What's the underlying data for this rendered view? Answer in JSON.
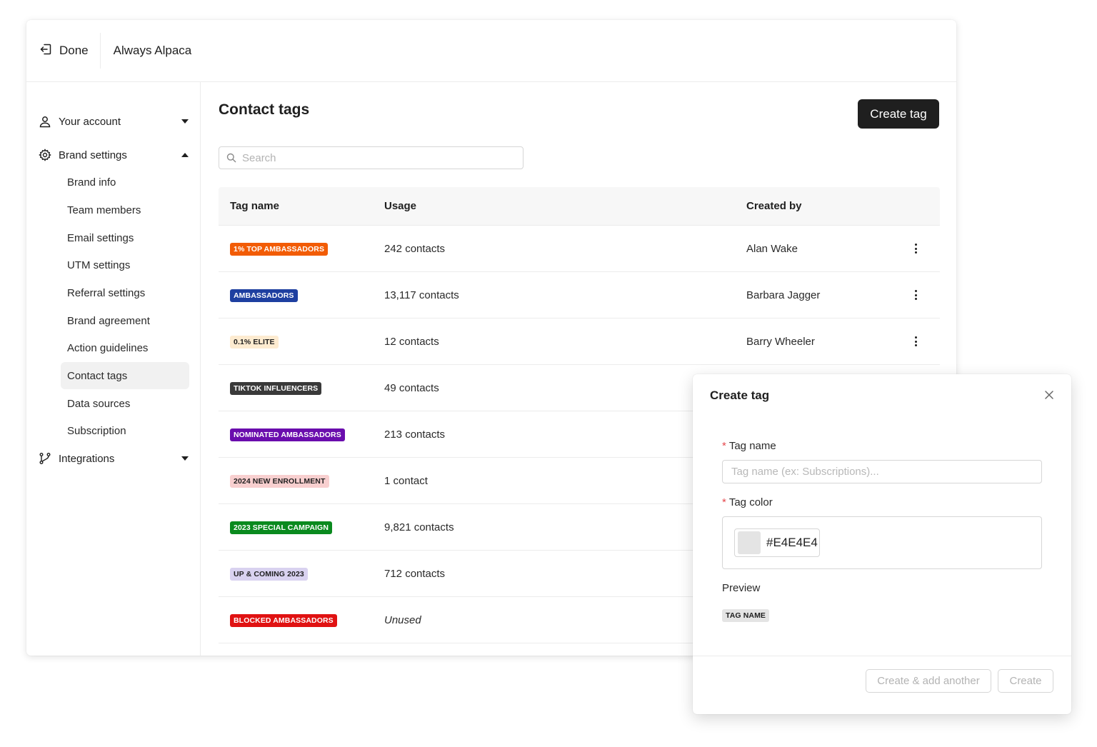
{
  "topbar": {
    "done_label": "Done",
    "brand_name": "Always Alpaca"
  },
  "sidebar": {
    "groups": [
      {
        "label": "Your account",
        "icon": "user-icon",
        "expanded": false
      },
      {
        "label": "Brand settings",
        "icon": "gear-icon",
        "expanded": true
      },
      {
        "label": "Integrations",
        "icon": "branch-icon",
        "expanded": false
      }
    ],
    "brand_items": [
      {
        "label": "Brand info"
      },
      {
        "label": "Team members"
      },
      {
        "label": "Email settings"
      },
      {
        "label": "UTM settings"
      },
      {
        "label": "Referral settings"
      },
      {
        "label": "Brand agreement"
      },
      {
        "label": "Action guidelines"
      },
      {
        "label": "Contact tags",
        "active": true
      },
      {
        "label": "Data sources"
      },
      {
        "label": "Subscription"
      }
    ]
  },
  "main": {
    "title": "Contact tags",
    "create_button": "Create tag",
    "search_placeholder": "Search"
  },
  "table": {
    "headers": [
      "Tag name",
      "Usage",
      "Created by"
    ],
    "rows": [
      {
        "tag": "1% TOP AMBASSADORS",
        "bg": "#F25C05",
        "fg": "#FFFFFF",
        "usage": "242 contacts",
        "created_by": "Alan Wake"
      },
      {
        "tag": "AMBASSADORS",
        "bg": "#1E3FA0",
        "fg": "#FFFFFF",
        "usage": "13,117 contacts",
        "created_by": "Barbara Jagger"
      },
      {
        "tag": "0.1% ELITE",
        "bg": "#FDEBD0",
        "fg": "#1F1F1F",
        "usage": "12 contacts",
        "created_by": "Barry Wheeler"
      },
      {
        "tag": "TIKTOK INFLUENCERS",
        "bg": "#3A3A3A",
        "fg": "#FFFFFF",
        "usage": "49 contacts",
        "created_by": ""
      },
      {
        "tag": "NOMINATED AMBASSADORS",
        "bg": "#6A0DAD",
        "fg": "#FFFFFF",
        "usage": "213 contacts",
        "created_by": ""
      },
      {
        "tag": "2024 NEW ENROLLMENT",
        "bg": "#F8CFCF",
        "fg": "#1F1F1F",
        "usage": "1 contact",
        "created_by": ""
      },
      {
        "tag": "2023 SPECIAL CAMPAIGN",
        "bg": "#0A8A1E",
        "fg": "#FFFFFF",
        "usage": "9,821 contacts",
        "created_by": ""
      },
      {
        "tag": "UP & COMING 2023",
        "bg": "#D9D2F0",
        "fg": "#1F1F1F",
        "usage": "712 contacts",
        "created_by": ""
      },
      {
        "tag": "BLOCKED AMBASSADORS",
        "bg": "#E01212",
        "fg": "#FFFFFF",
        "usage": "Unused",
        "usage_unused": true,
        "created_by": ""
      }
    ]
  },
  "modal": {
    "title": "Create tag",
    "tag_name_label": "Tag name",
    "tag_name_placeholder": "Tag name (ex: Subscriptions)...",
    "tag_color_label": "Tag color",
    "color_hex": "#E4E4E4",
    "preview_label": "Preview",
    "preview_tag": "TAG NAME",
    "create_add_another": "Create & add another",
    "create": "Create",
    "required_mark": "*"
  }
}
